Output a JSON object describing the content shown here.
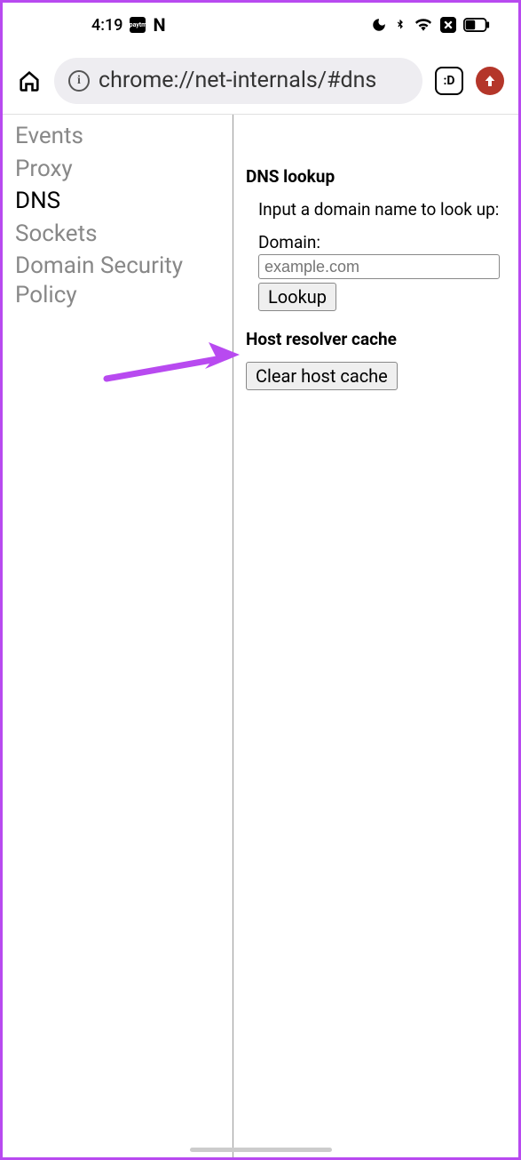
{
  "status": {
    "time": "4:19",
    "app_icon_label": "paytm",
    "app_letter": "N"
  },
  "browser": {
    "url": "chrome://net-internals/#dns",
    "tab_indicator": ":D"
  },
  "sidebar": {
    "items": [
      {
        "label": "Events",
        "active": false
      },
      {
        "label": "Proxy",
        "active": false
      },
      {
        "label": "DNS",
        "active": true
      },
      {
        "label": "Sockets",
        "active": false
      },
      {
        "label": "Domain Security Policy",
        "active": false
      }
    ]
  },
  "dns": {
    "lookup_heading": "DNS lookup",
    "lookup_instruction": "Input a domain name to look up:",
    "domain_label": "Domain:",
    "domain_placeholder": "example.com",
    "lookup_button": "Lookup",
    "cache_heading": "Host resolver cache",
    "clear_button": "Clear host cache"
  }
}
